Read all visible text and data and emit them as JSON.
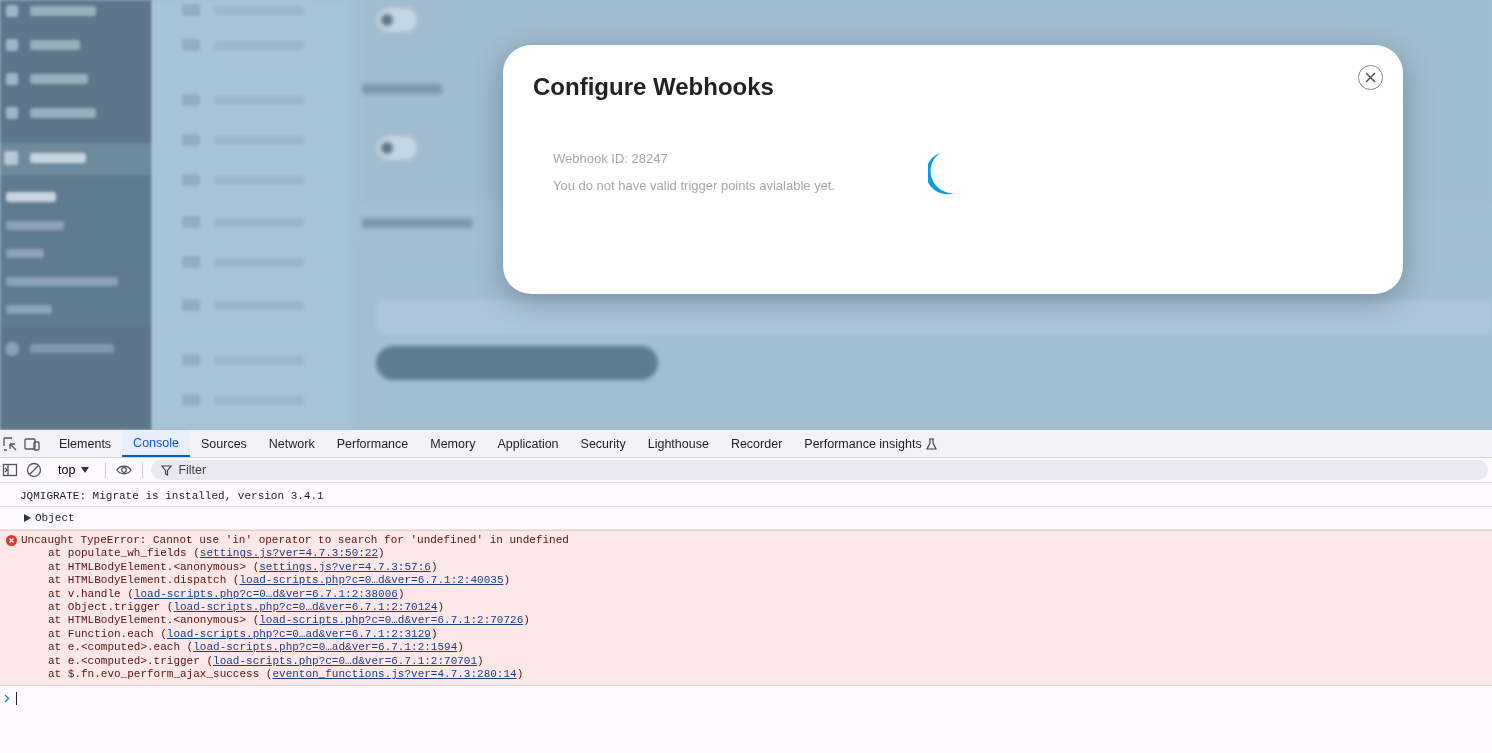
{
  "modal": {
    "title": "Configure Webhooks",
    "webhook_id": "Webhook ID: 28247",
    "message": "You do not have valid trigger points avialable yet."
  },
  "devtools": {
    "tabs": [
      {
        "label": "Elements",
        "selected": false
      },
      {
        "label": "Console",
        "selected": true
      },
      {
        "label": "Sources",
        "selected": false
      },
      {
        "label": "Network",
        "selected": false
      },
      {
        "label": "Performance",
        "selected": false
      },
      {
        "label": "Memory",
        "selected": false
      },
      {
        "label": "Application",
        "selected": false
      },
      {
        "label": "Security",
        "selected": false
      },
      {
        "label": "Lighthouse",
        "selected": false
      },
      {
        "label": "Recorder",
        "selected": false
      },
      {
        "label": "Performance insights",
        "selected": false
      }
    ],
    "context": "top",
    "filter_placeholder": "Filter",
    "messages": [
      {
        "kind": "log",
        "text": "JQMIGRATE: Migrate is installed, version 3.4.1"
      },
      {
        "kind": "object",
        "text": "Object",
        "expanded": false
      },
      {
        "kind": "error",
        "text": "Uncaught TypeError: Cannot use 'in' operator to search for 'undefined' in undefined",
        "stack": [
          {
            "prefix": "at populate_wh_fields (",
            "link": "settings.js?ver=4.7.3:50:22",
            "suffix": ")"
          },
          {
            "prefix": "at HTMLBodyElement.<anonymous> (",
            "link": "settings.js?ver=4.7.3:57:6",
            "suffix": ")"
          },
          {
            "prefix": "at HTMLBodyElement.dispatch (",
            "link": "load-scripts.php?c=0…d&ver=6.7.1:2:40035",
            "suffix": ")"
          },
          {
            "prefix": "at v.handle (",
            "link": "load-scripts.php?c=0…d&ver=6.7.1:2:38006",
            "suffix": ")"
          },
          {
            "prefix": "at Object.trigger (",
            "link": "load-scripts.php?c=0…d&ver=6.7.1:2:70124",
            "suffix": ")"
          },
          {
            "prefix": "at HTMLBodyElement.<anonymous> (",
            "link": "load-scripts.php?c=0…d&ver=6.7.1:2:70726",
            "suffix": ")"
          },
          {
            "prefix": "at Function.each (",
            "link": "load-scripts.php?c=0…ad&ver=6.7.1:2:3129",
            "suffix": ")"
          },
          {
            "prefix": "at e.<computed>.each (",
            "link": "load-scripts.php?c=0…ad&ver=6.7.1:2:1594",
            "suffix": ")"
          },
          {
            "prefix": "at e.<computed>.trigger (",
            "link": "load-scripts.php?c=0…d&ver=6.7.1:2:70701",
            "suffix": ")"
          },
          {
            "prefix": "at $.fn.evo_perform_ajax_success (",
            "link": "eventon_functions.js?ver=4.7.3:280:14",
            "suffix": ")"
          }
        ]
      }
    ]
  }
}
